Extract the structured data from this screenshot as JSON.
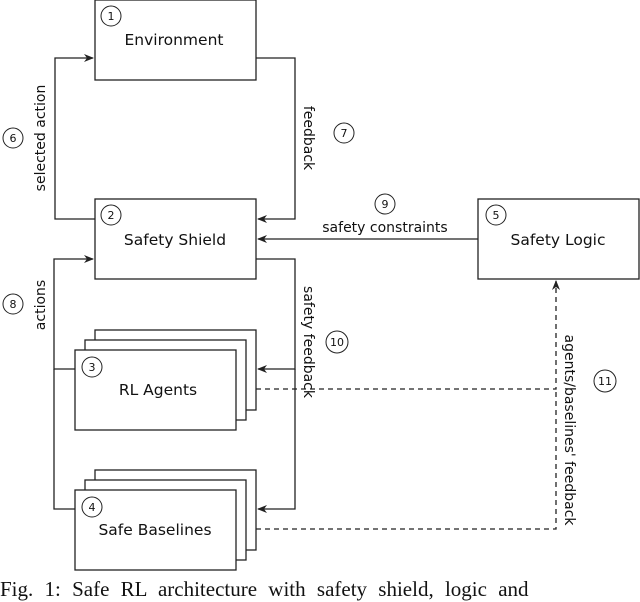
{
  "nodes": {
    "environment": {
      "num": "1",
      "label": "Environment"
    },
    "safety_shield": {
      "num": "2",
      "label": "Safety Shield"
    },
    "rl_agents": {
      "num": "3",
      "label": "RL Agents"
    },
    "safe_baselines": {
      "num": "4",
      "label": "Safe Baselines"
    },
    "safety_logic": {
      "num": "5",
      "label": "Safety Logic"
    }
  },
  "edges": {
    "selected_action": {
      "num": "6",
      "label": "selected action"
    },
    "feedback": {
      "num": "7",
      "label": "feedback"
    },
    "actions": {
      "num": "8",
      "label": "actions"
    },
    "safety_constraints": {
      "num": "9",
      "label": "safety constraints"
    },
    "safety_feedback": {
      "num": "10",
      "label": "safety feedback"
    },
    "agents_feedback": {
      "num": "11",
      "label": "agents/baselines' feedback"
    }
  },
  "caption": "Fig. 1: Safe RL architecture with safety shield, logic and"
}
